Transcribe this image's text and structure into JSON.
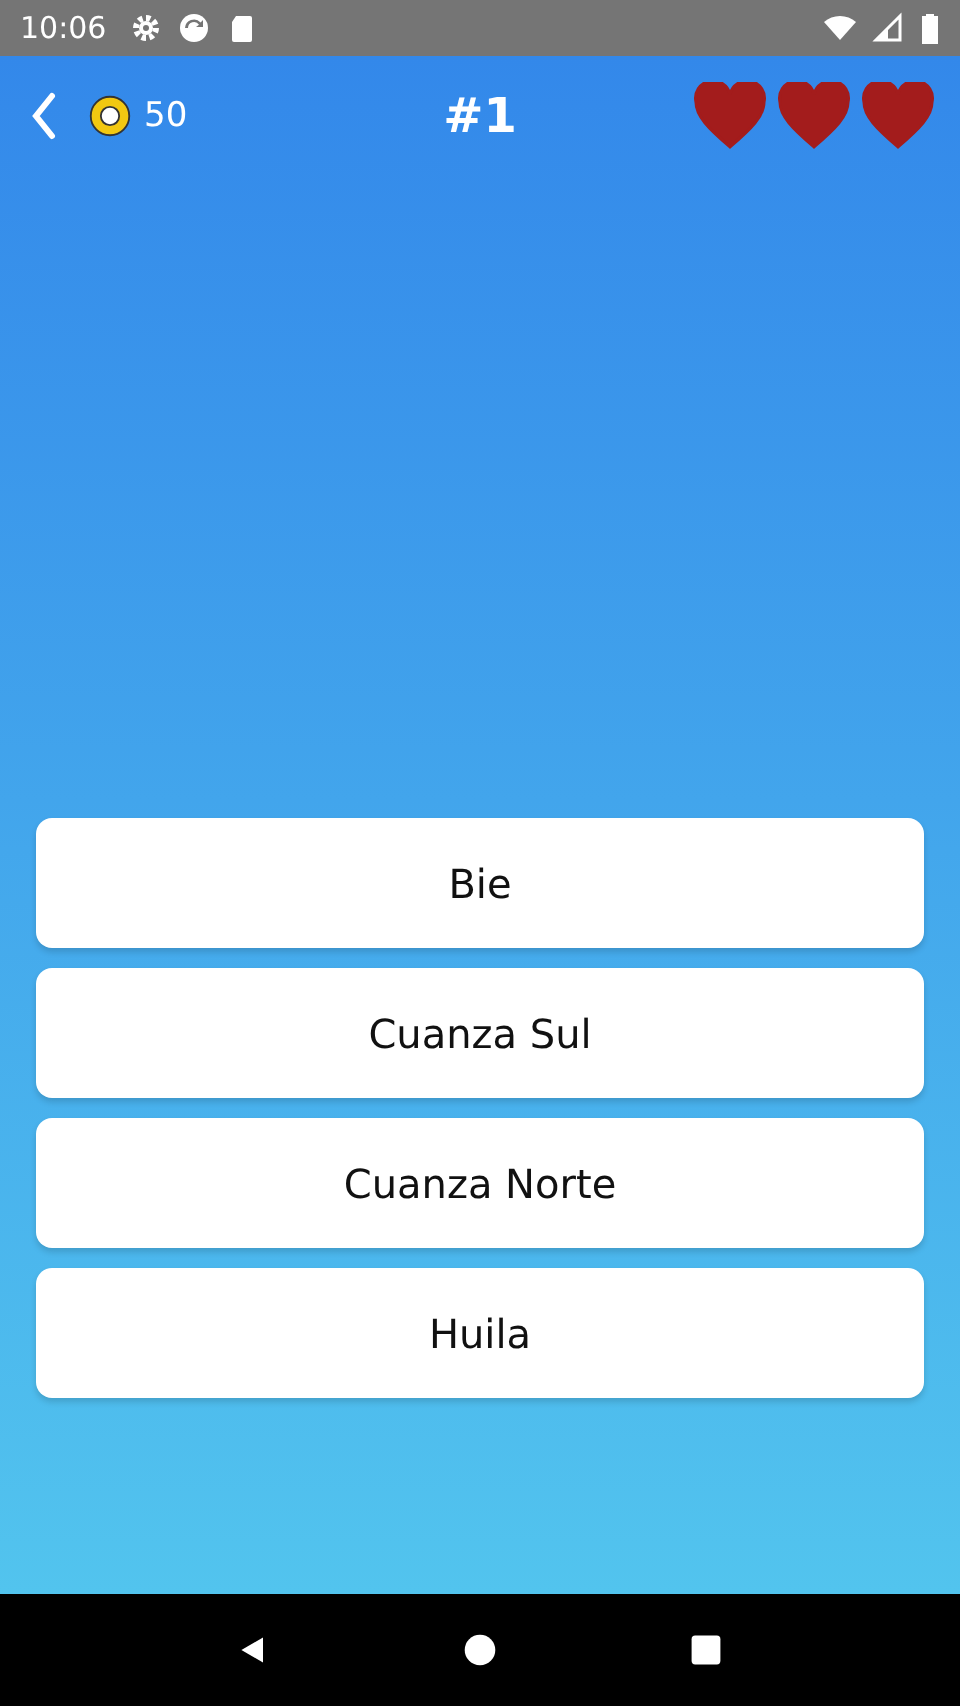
{
  "status_bar": {
    "time": "10:06"
  },
  "header": {
    "coins": "50",
    "title": "#1",
    "lives": [
      {
        "filled": true
      },
      {
        "filled": true
      },
      {
        "filled": true
      }
    ]
  },
  "answers": [
    {
      "label": "Bie"
    },
    {
      "label": "Cuanza Sul"
    },
    {
      "label": "Cuanza Norte"
    },
    {
      "label": "Huila"
    }
  ]
}
